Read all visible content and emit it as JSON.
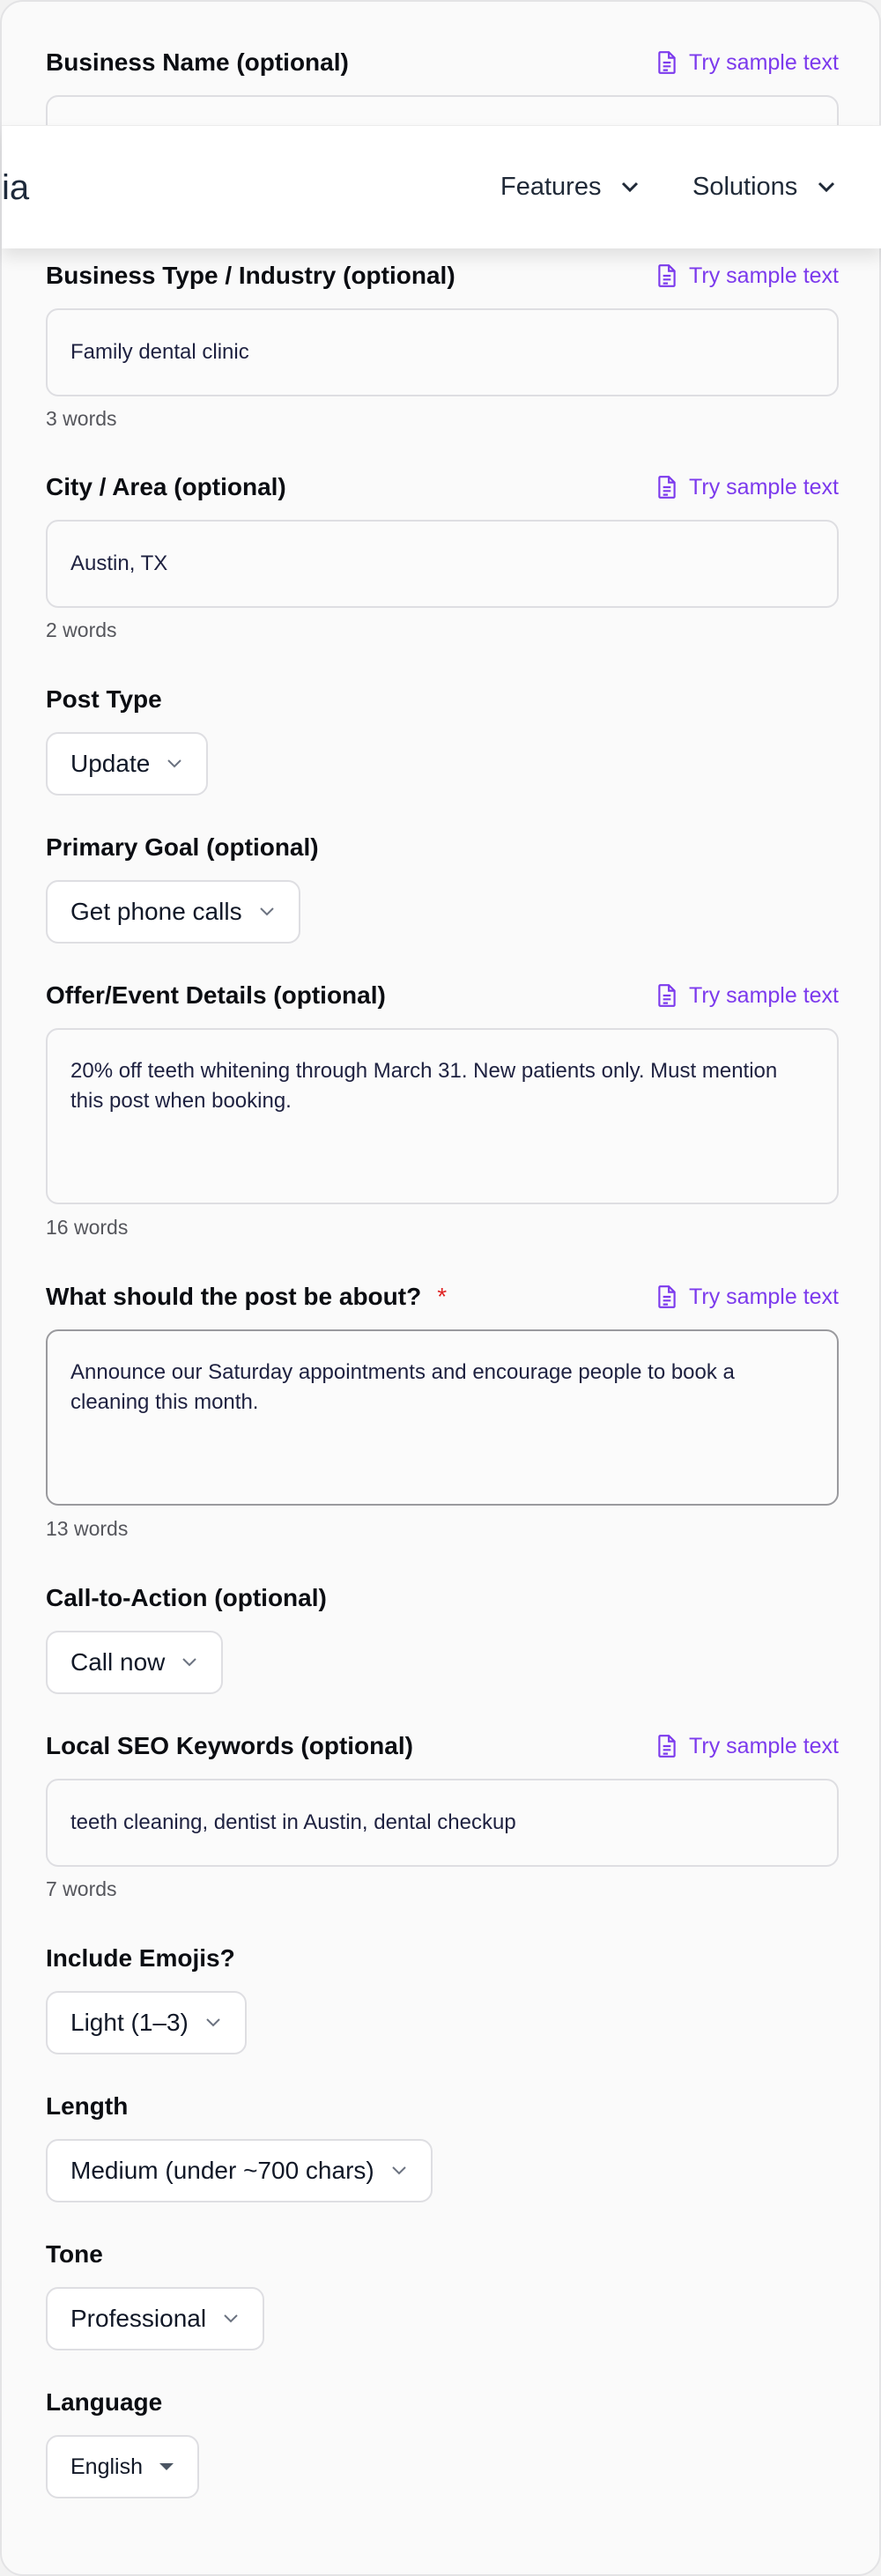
{
  "header": {
    "logo_text": "ia",
    "nav": [
      {
        "label": "Features"
      },
      {
        "label": "Solutions"
      }
    ]
  },
  "sample_link_label": "Try sample text",
  "fields": {
    "business_name": {
      "label": "Business Name (optional)",
      "value": ""
    },
    "business_type": {
      "label": "Business Type / Industry (optional)",
      "value": "Family dental clinic",
      "word_count": "3 words"
    },
    "city": {
      "label": "City / Area (optional)",
      "value": "Austin, TX",
      "word_count": "2 words"
    },
    "post_type": {
      "label": "Post Type",
      "selected": "Update"
    },
    "primary_goal": {
      "label": "Primary Goal (optional)",
      "selected": "Get phone calls"
    },
    "offer": {
      "label": "Offer/Event Details (optional)",
      "value": "20% off teeth whitening through March 31. New patients only. Must mention this post when booking.",
      "word_count": "16 words"
    },
    "topic": {
      "label": "What should the post be about?",
      "required_mark": "*",
      "value": "Announce our Saturday appointments and encourage people to book a cleaning this month.",
      "word_count": "13 words"
    },
    "cta": {
      "label": "Call-to-Action (optional)",
      "selected": "Call now"
    },
    "keywords": {
      "label": "Local SEO Keywords (optional)",
      "value": "teeth cleaning, dentist in Austin, dental checkup",
      "word_count": "7 words"
    },
    "emojis": {
      "label": "Include Emojis?",
      "selected": "Light (1–3)"
    },
    "length": {
      "label": "Length",
      "selected": "Medium (under ~700 chars)"
    },
    "tone": {
      "label": "Tone",
      "selected": "Professional"
    },
    "language": {
      "label": "Language",
      "selected": "English"
    }
  },
  "colors": {
    "accent": "#7c3aed",
    "required": "#e02424",
    "border": "#dedee2",
    "text": "#0b0d12"
  }
}
